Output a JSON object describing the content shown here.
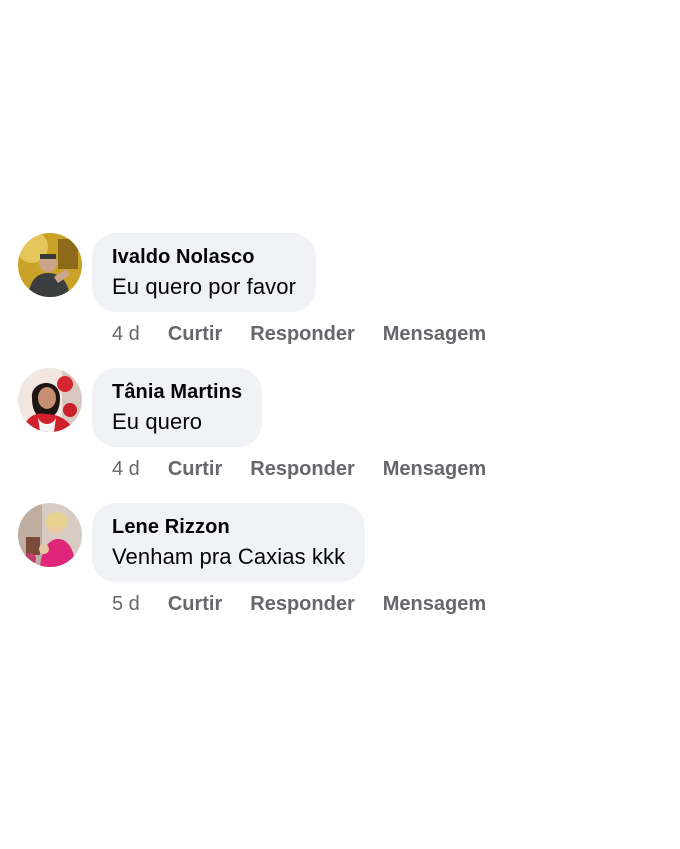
{
  "comments": [
    {
      "author": "Ivaldo Nolasco",
      "text": "Eu quero por favor",
      "time": "4 d",
      "like_label": "Curtir",
      "reply_label": "Responder",
      "message_label": "Mensagem"
    },
    {
      "author": "Tânia Martins",
      "text": "Eu quero",
      "time": "4 d",
      "like_label": "Curtir",
      "reply_label": "Responder",
      "message_label": "Mensagem"
    },
    {
      "author": "Lene Rizzon",
      "text": "Venham pra Caxias kkk",
      "time": "5 d",
      "like_label": "Curtir",
      "reply_label": "Responder",
      "message_label": "Mensagem"
    }
  ],
  "colors": {
    "bubble_background": "#f0f2f5",
    "author_text": "#050505",
    "action_text": "#65676b"
  }
}
